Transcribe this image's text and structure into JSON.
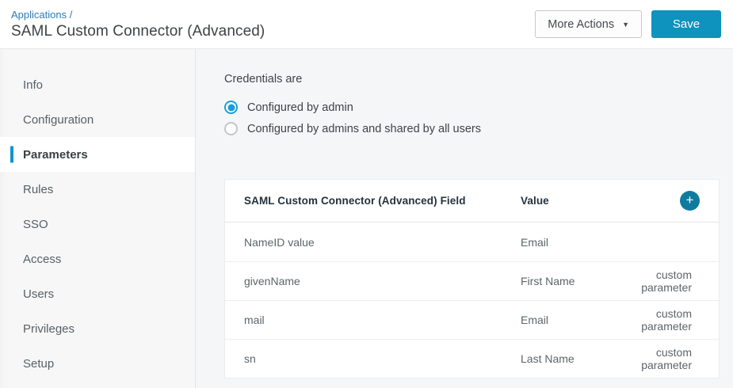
{
  "header": {
    "breadcrumb": "Applications /",
    "title": "SAML Custom Connector (Advanced)",
    "more_actions_label": "More Actions",
    "more_actions_caret": "▼",
    "save_label": "Save"
  },
  "sidebar": {
    "items": [
      {
        "label": "Info",
        "active": false
      },
      {
        "label": "Configuration",
        "active": false
      },
      {
        "label": "Parameters",
        "active": true
      },
      {
        "label": "Rules",
        "active": false
      },
      {
        "label": "SSO",
        "active": false
      },
      {
        "label": "Access",
        "active": false
      },
      {
        "label": "Users",
        "active": false
      },
      {
        "label": "Privileges",
        "active": false
      },
      {
        "label": "Setup",
        "active": false
      }
    ]
  },
  "credentials": {
    "label": "Credentials are",
    "options": [
      {
        "label": "Configured by admin",
        "selected": true
      },
      {
        "label": "Configured by admins and shared by all users",
        "selected": false
      }
    ]
  },
  "table": {
    "columns": [
      "SAML Custom Connector (Advanced) Field",
      "Value"
    ],
    "add_button_glyph": "+",
    "rows": [
      {
        "field": "NameID value",
        "value": "Email",
        "note": ""
      },
      {
        "field": "givenName",
        "value": "First Name",
        "note": "custom parameter"
      },
      {
        "field": "mail",
        "value": "Email",
        "note": "custom parameter"
      },
      {
        "field": "sn",
        "value": "Last Name",
        "note": "custom parameter"
      }
    ]
  },
  "colors": {
    "save_button": "#0d93bd",
    "add_button": "#107b9e",
    "radio_selected": "#1a9dd8",
    "active_indicator": "#1295c9",
    "breadcrumb_link": "#2d7cb8"
  }
}
